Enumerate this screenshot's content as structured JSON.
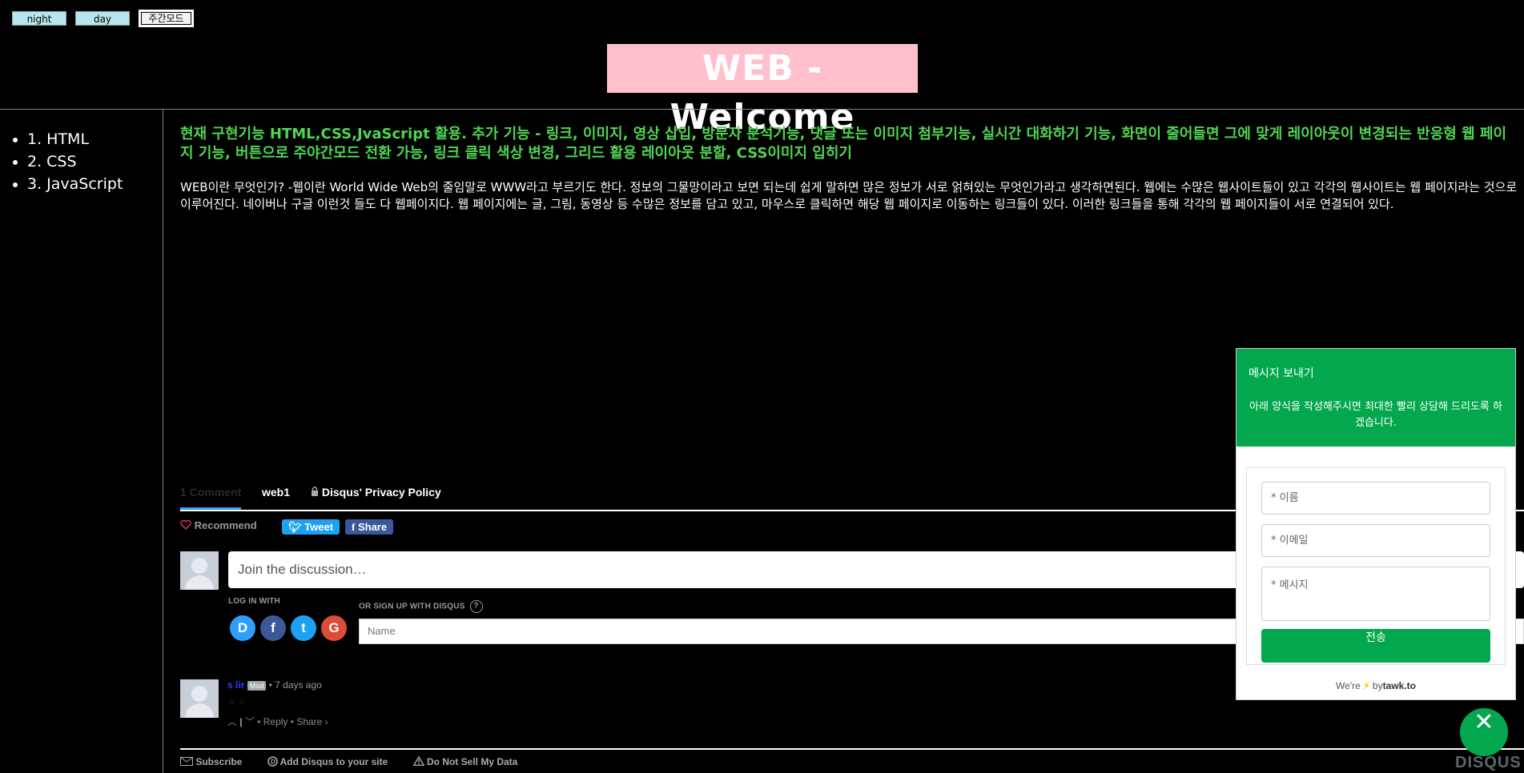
{
  "mode_buttons": {
    "night": "night",
    "day": "day",
    "weekly": "주간모드"
  },
  "header": {
    "title": "WEB - Welcome"
  },
  "toc": {
    "items": [
      {
        "label": "1. HTML"
      },
      {
        "label": "2. CSS"
      },
      {
        "label": "3. JavaScript"
      }
    ]
  },
  "main": {
    "heading": "현재 구현기능 HTML,CSS,JvaScript 활용. 추가 기능 - 링크, 이미지, 영상 삽입, 방문자 분석기능, 댓글 또는 이미지 첨부기능, 실시간 대화하기 기능, 화면이 줄어들면 그에 맞게 레이아웃이 변경되는 반응형 웹 페이지 기능, 버튼으로 주야간모드 전환 가능, 링크 클릭 색상 변경, 그리드 활용 레이아웃 분할, CSS이미지 입히기",
    "body": "WEB이란 무엇인가? -웹이란 World Wide Web의 줄임말로 WWW라고 부르기도 한다. 정보의 그물망이라고 보면 되는데 쉽게 말하면 많은 정보가 서로 얽혀있는 무엇인가라고 생각하면된다. 웹에는 수많은 웹사이트들이 있고 각각의 웹사이트는 웹 페이지라는 것으로 이루어진다. 네이버나 구글 이런것 들도 다 웹페이지다. 웹 페이지에는 글, 그림, 동영상 등 수많은 정보를 담고 있고, 마우스로 클릭하면 해당 웹 페이지로 이동하는 링크들이 있다. 이러한 링크들을 통해 각각의 웹 페이지들이 서로 연결되어 있다."
  },
  "disqus": {
    "tabs": {
      "comments": "1 Comment",
      "community": "web1",
      "privacy": "Disqus' Privacy Policy"
    },
    "recommend": "Recommend",
    "tweet": "Tweet",
    "share": "Share",
    "join_placeholder": "Join the discussion…",
    "log_in_with": "LOG IN WITH",
    "or_sign_up": "OR SIGN UP WITH DISQUS",
    "help_mark": "?",
    "name_placeholder": "Name",
    "social": {
      "disqus": "D",
      "facebook": "f",
      "twitter": "t",
      "google": "G"
    },
    "comment": {
      "author": "s lir",
      "badge": "Mod",
      "separator": "•",
      "time": "7 days ago",
      "body": "☆ ☆",
      "reply": "Reply",
      "share": "Share ›"
    },
    "footer": {
      "subscribe": "Subscribe",
      "add_disqus": "Add Disqus to your site",
      "do_not_sell": "Do Not Sell My Data"
    },
    "logo": "DISQUS"
  },
  "tawk": {
    "title": "메시지 보내기",
    "description": "아래 양식을 작성해주시면 최대한 빨리 상담해 드리도록 하겠습니다.",
    "name_placeholder": "* 이름",
    "email_placeholder": "* 이메일",
    "message_placeholder": "* 메시지",
    "submit": "전송",
    "footer_prefix": "We're",
    "footer_by": "by",
    "footer_brand": "tawk.to",
    "close_glyph": "✕"
  },
  "colors": {
    "heading_green": "#4fd651",
    "title_bg": "#ffc0cb",
    "tawk_green": "#03a84e",
    "tweet_blue": "#1da1f2",
    "facebook_blue": "#3b5998",
    "tab_underline": "#2e9fff"
  },
  "icons": {
    "heart": "heart-icon",
    "lock": "lock-icon",
    "mail": "mail-icon",
    "disqus": "disqus-icon",
    "warning": "warning-icon",
    "upvote": "chevron-up-icon",
    "downvote": "chevron-down-icon",
    "close": "close-icon",
    "bolt": "bolt-icon"
  }
}
